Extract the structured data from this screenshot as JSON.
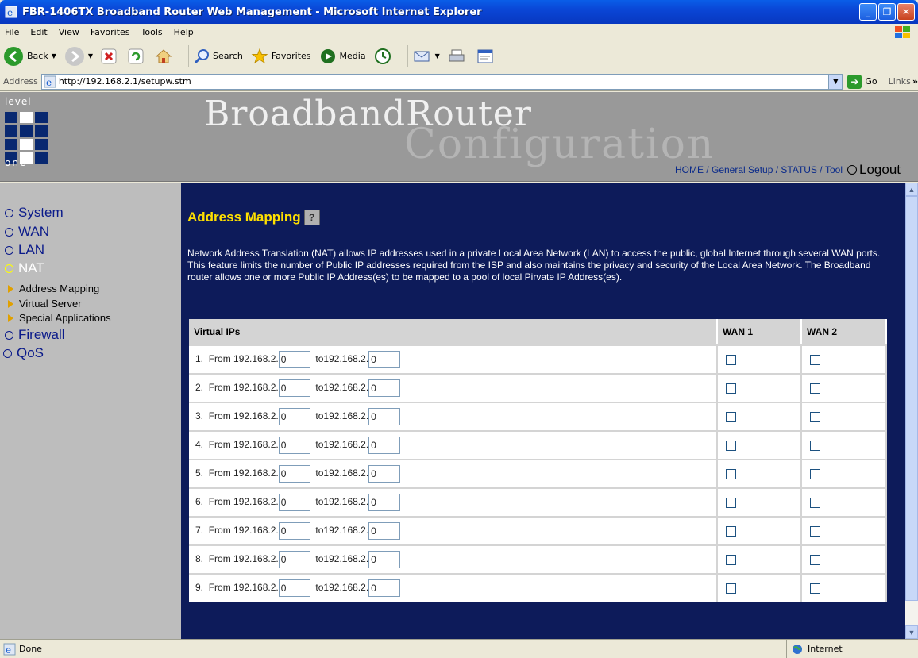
{
  "window": {
    "title": "FBR-1406TX Broadband Router Web Management - Microsoft Internet Explorer"
  },
  "menu": [
    "File",
    "Edit",
    "View",
    "Favorites",
    "Tools",
    "Help"
  ],
  "toolbar": {
    "back": "Back",
    "search": "Search",
    "favorites": "Favorites",
    "media": "Media"
  },
  "address": {
    "label": "Address",
    "url": "http://192.168.2.1/setupw.stm",
    "go": "Go",
    "links": "Links"
  },
  "header": {
    "logo_top": "level",
    "logo_bottom": "one",
    "brand_line1": "BroadbandRouter",
    "brand_line2": "Configuration",
    "nav": {
      "home": "HOME",
      "general": "General Setup",
      "status": "STATUS",
      "tool": "Tool",
      "logout": "Logout"
    }
  },
  "sidebar": {
    "system": "System",
    "wan": "WAN",
    "lan": "LAN",
    "nat": "NAT",
    "sub": [
      "Address Mapping",
      "Virtual Server",
      "Special Applications"
    ],
    "firewall": "Firewall",
    "qos": "QoS"
  },
  "content": {
    "title": "Address Mapping",
    "description": "Network Address Translation (NAT) allows IP addresses used in a private Local Area Network (LAN) to access the public, global Internet through several WAN ports. This feature limits the number of Public IP addresses required from the ISP and also maintains the privacy and security of the Local Area Network. The Broadband router allows one or more Public IP Address(es) to be mapped to a pool of local Pirvate IP Address(es).",
    "table_headers": {
      "virtual_ips": "Virtual IPs",
      "wan1": "WAN 1",
      "wan2": "WAN 2"
    },
    "rows": [
      {
        "num": "1.",
        "from": "From 192.168.2.",
        "from_val": "0",
        "to": "to192.168.2.",
        "to_val": "0"
      },
      {
        "num": "2.",
        "from": "From 192.168.2.",
        "from_val": "0",
        "to": "to192.168.2.",
        "to_val": "0"
      },
      {
        "num": "3.",
        "from": "From 192.168.2.",
        "from_val": "0",
        "to": "to192.168.2.",
        "to_val": "0"
      },
      {
        "num": "4.",
        "from": "From 192.168.2.",
        "from_val": "0",
        "to": "to192.168.2.",
        "to_val": "0"
      },
      {
        "num": "5.",
        "from": "From 192.168.2.",
        "from_val": "0",
        "to": "to192.168.2.",
        "to_val": "0"
      },
      {
        "num": "6.",
        "from": "From 192.168.2.",
        "from_val": "0",
        "to": "to192.168.2.",
        "to_val": "0"
      },
      {
        "num": "7.",
        "from": "From 192.168.2.",
        "from_val": "0",
        "to": "to192.168.2.",
        "to_val": "0"
      },
      {
        "num": "8.",
        "from": "From 192.168.2.",
        "from_val": "0",
        "to": "to192.168.2.",
        "to_val": "0"
      },
      {
        "num": "9.",
        "from": "From 192.168.2.",
        "from_val": "0",
        "to": "to192.168.2.",
        "to_val": "0"
      }
    ]
  },
  "status": {
    "text": "Done",
    "zone": "Internet"
  }
}
